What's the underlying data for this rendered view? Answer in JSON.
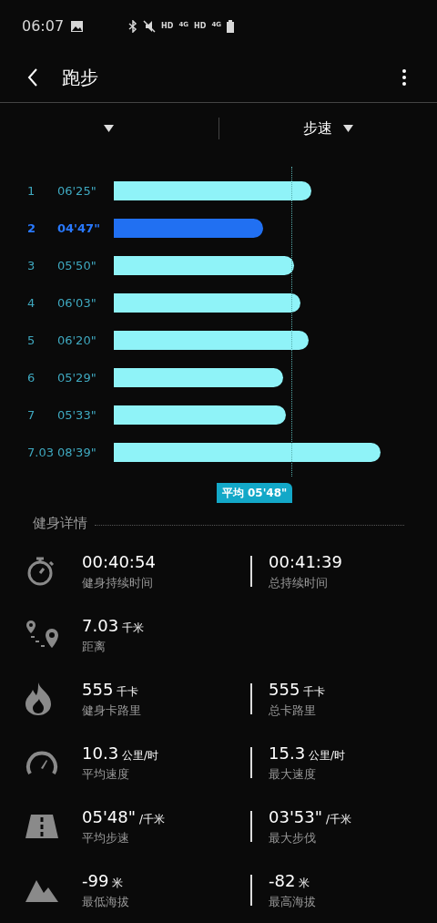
{
  "status_bar": {
    "time": "06:07",
    "indicators": [
      "HD",
      "4G",
      "HD",
      "4G"
    ]
  },
  "header": {
    "title": "跑步"
  },
  "selectors": [
    {
      "kind": "arrow_only"
    },
    {
      "kind": "labeled",
      "label": "步速"
    }
  ],
  "splits": [
    {
      "index": "1",
      "pace": "06'25\"",
      "selected": false
    },
    {
      "index": "2",
      "pace": "04'47\"",
      "selected": true
    },
    {
      "index": "3",
      "pace": "05'50\"",
      "selected": false
    },
    {
      "index": "4",
      "pace": "06'03\"",
      "selected": false
    },
    {
      "index": "5",
      "pace": "06'20\"",
      "selected": false
    },
    {
      "index": "6",
      "pace": "05'29\"",
      "selected": false
    },
    {
      "index": "7",
      "pace": "05'33\"",
      "selected": false
    },
    {
      "index": "7.03",
      "pace": "08'39\"",
      "selected": false
    }
  ],
  "average": {
    "label": "平均 05'48\""
  },
  "details": {
    "title": "健身详情",
    "rows": [
      {
        "kind": "stopwatch",
        "cells": [
          {
            "value": "00:40:54",
            "label": "健身持续时间"
          },
          {
            "value": "00:41:39",
            "label": "总持续时间"
          }
        ]
      },
      {
        "kind": "route",
        "cells": [
          {
            "value": "7.03",
            "unit": "千米",
            "label": "距离"
          }
        ]
      },
      {
        "kind": "flame",
        "cells": [
          {
            "value": "555",
            "unit": "千卡",
            "label": "健身卡路里"
          },
          {
            "value": "555",
            "unit": "千卡",
            "label": "总卡路里"
          }
        ]
      },
      {
        "kind": "gauge",
        "cells": [
          {
            "value": "10.3",
            "unit": "公里/时",
            "label": "平均速度"
          },
          {
            "value": "15.3",
            "unit": "公里/时",
            "label": "最大速度"
          }
        ]
      },
      {
        "kind": "road",
        "cells": [
          {
            "value": "05'48\"",
            "unit": "/千米",
            "label": "平均步速"
          },
          {
            "value": "03'53\"",
            "unit": "/千米",
            "label": "最大步伐"
          }
        ]
      },
      {
        "kind": "mountain",
        "cells": [
          {
            "value": "-99",
            "unit": "米",
            "label": "最低海拔"
          },
          {
            "value": "-82",
            "unit": "米",
            "label": "最高海拔"
          }
        ]
      }
    ]
  }
}
